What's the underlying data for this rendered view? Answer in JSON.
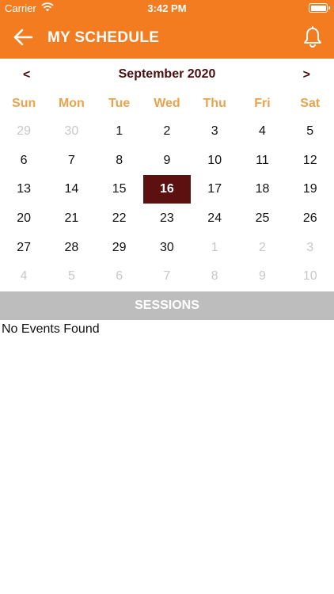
{
  "status_bar": {
    "carrier": "Carrier",
    "time": "3:42 PM"
  },
  "nav": {
    "title": "MY SCHEDULE",
    "back_icon": "arrow-left-icon",
    "bell_icon": "bell-icon"
  },
  "calendar": {
    "month_label": "September 2020",
    "prev": "<",
    "next": ">",
    "weekdays": [
      "Sun",
      "Mon",
      "Tue",
      "Wed",
      "Thu",
      "Fri",
      "Sat"
    ],
    "selected_day": "16",
    "weeks": [
      [
        {
          "d": "29",
          "m": true
        },
        {
          "d": "30",
          "m": true
        },
        {
          "d": "1"
        },
        {
          "d": "2"
        },
        {
          "d": "3"
        },
        {
          "d": "4"
        },
        {
          "d": "5"
        }
      ],
      [
        {
          "d": "6"
        },
        {
          "d": "7"
        },
        {
          "d": "8"
        },
        {
          "d": "9"
        },
        {
          "d": "10"
        },
        {
          "d": "11"
        },
        {
          "d": "12"
        }
      ],
      [
        {
          "d": "13"
        },
        {
          "d": "14"
        },
        {
          "d": "15"
        },
        {
          "d": "16",
          "s": true
        },
        {
          "d": "17"
        },
        {
          "d": "18"
        },
        {
          "d": "19"
        }
      ],
      [
        {
          "d": "20"
        },
        {
          "d": "21"
        },
        {
          "d": "22"
        },
        {
          "d": "23"
        },
        {
          "d": "24"
        },
        {
          "d": "25"
        },
        {
          "d": "26"
        }
      ],
      [
        {
          "d": "27"
        },
        {
          "d": "28"
        },
        {
          "d": "29"
        },
        {
          "d": "30"
        },
        {
          "d": "1",
          "m": true
        },
        {
          "d": "2",
          "m": true
        },
        {
          "d": "3",
          "m": true
        }
      ],
      [
        {
          "d": "4",
          "m": true
        },
        {
          "d": "5",
          "m": true
        },
        {
          "d": "6",
          "m": true
        },
        {
          "d": "7",
          "m": true
        },
        {
          "d": "8",
          "m": true
        },
        {
          "d": "9",
          "m": true
        },
        {
          "d": "10",
          "m": true
        }
      ]
    ]
  },
  "sessions": {
    "header": "SESSIONS",
    "empty_message": "No Events Found"
  },
  "colors": {
    "brand_orange": "#f47c20",
    "selected_day_bg": "#5c1010",
    "weekday_label": "#e8a44c",
    "sessions_header_bg": "#bdbdbd"
  }
}
